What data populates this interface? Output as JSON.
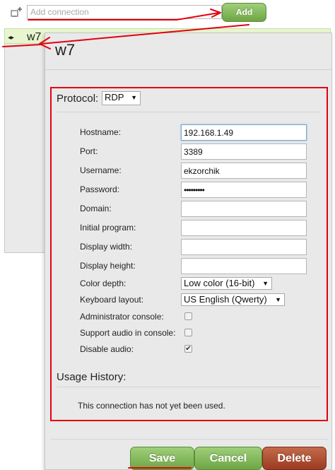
{
  "toolbar": {
    "add_icon": "add-connection-icon",
    "add_placeholder": "Add connection",
    "add_label": "Add"
  },
  "connection_list": {
    "items": [
      {
        "icon": "connection-icon",
        "name": "w7"
      }
    ]
  },
  "editor": {
    "title": "w7",
    "protocol_label": "Protocol:",
    "protocol_value": "RDP",
    "fields": {
      "hostname": {
        "label": "Hostname:",
        "value": "192.168.1.49"
      },
      "port": {
        "label": "Port:",
        "value": "3389"
      },
      "username": {
        "label": "Username:",
        "value": "ekzorchik"
      },
      "password": {
        "label": "Password:",
        "value": "•••••••••"
      },
      "domain": {
        "label": "Domain:",
        "value": ""
      },
      "initial_program": {
        "label": "Initial program:",
        "value": ""
      },
      "display_width": {
        "label": "Display width:",
        "value": ""
      },
      "display_height": {
        "label": "Display height:",
        "value": ""
      },
      "color_depth": {
        "label": "Color depth:",
        "value": "Low color (16-bit)"
      },
      "keyboard_layout": {
        "label": "Keyboard layout:",
        "value": "US English (Qwerty)"
      },
      "admin_console": {
        "label": "Administrator console:",
        "checked": false
      },
      "audio_in_console": {
        "label": "Support audio in console:",
        "checked": false
      },
      "disable_audio": {
        "label": "Disable audio:",
        "checked": true
      }
    },
    "usage_title": "Usage History:",
    "usage_text": "This connection has not yet been used.",
    "buttons": {
      "save": "Save",
      "cancel": "Cancel",
      "delete": "Delete"
    }
  },
  "colors": {
    "annotation": "#e3000f",
    "green_button": "#7cb356",
    "red_button": "#a9452a",
    "selected_row": "#e7f6cf"
  }
}
